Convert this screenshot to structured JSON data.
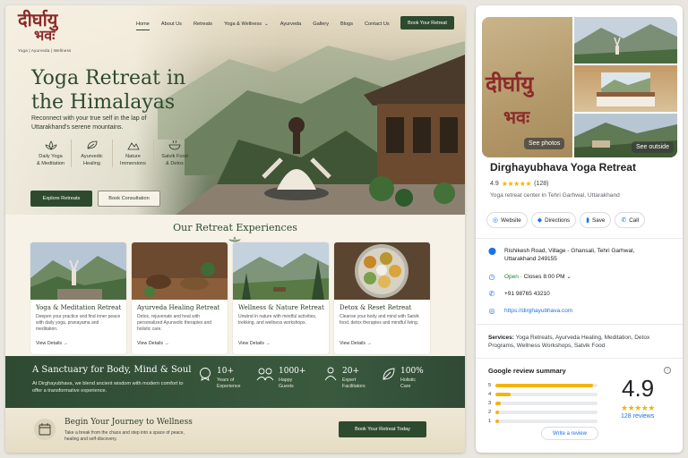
{
  "site": {
    "logo": {
      "line1": "दीर्घायु",
      "line2": "भवः",
      "tagline": "Yoga | Ayurveda | Wellness"
    },
    "nav": [
      "Home",
      "About Us",
      "Retreats",
      "Yoga & Wellness",
      "Ayurveda",
      "Gallery",
      "Blogs",
      "Contact Us"
    ],
    "nav_book": "Book Your Retreat",
    "hero": {
      "title_line1": "Yoga Retreat in",
      "title_line2": "the Himalayas",
      "subtitle": "Reconnect with your true self in the lap of Uttarakhand's serene mountains.",
      "features": [
        {
          "icon": "lotus-icon",
          "label1": "Daily Yoga",
          "label2": "& Meditation"
        },
        {
          "icon": "leaf-icon",
          "label1": "Ayurvedic",
          "label2": "Healing"
        },
        {
          "icon": "mountain-icon",
          "label1": "Nature",
          "label2": "Immersions"
        },
        {
          "icon": "bowl-icon",
          "label1": "Satvik Food",
          "label2": "& Detox"
        }
      ],
      "btn_primary": "Explore Retreats",
      "btn_secondary": "Book Consultation"
    },
    "experiences_title": "Our Retreat Experiences",
    "cards": [
      {
        "title": "Yoga & Meditation Retreat",
        "desc": "Deepen your practice and find inner peace with daily yoga, pranayama and meditation.",
        "link": "View Details →"
      },
      {
        "title": "Ayurveda Healing Retreat",
        "desc": "Detox, rejuvenate and heal with personalized Ayurvedic therapies and holistic care.",
        "link": "View Details →"
      },
      {
        "title": "Wellness & Nature Retreat",
        "desc": "Unwind in nature with mindful activities, trekking, and wellness workshops.",
        "link": "View Details →"
      },
      {
        "title": "Detox & Reset Retreat",
        "desc": "Cleanse your body and mind with Satvik food, detox therapies and mindful living.",
        "link": "View Details →"
      }
    ],
    "band": {
      "title": "A Sanctuary for Body, Mind & Soul",
      "desc": "At Dirghayubhava, we blend ancient wisdom with modern comfort to offer a transformative experience.",
      "stats": [
        {
          "icon": "badge-icon",
          "num": "10+",
          "l1": "Years of",
          "l2": "Experience"
        },
        {
          "icon": "people-icon",
          "num": "1000+",
          "l1": "Happy",
          "l2": "Guests"
        },
        {
          "icon": "teacher-icon",
          "num": "20+",
          "l1": "Expert",
          "l2": "Facilitators"
        },
        {
          "icon": "leaf-icon",
          "num": "100%",
          "l1": "Holistic",
          "l2": "Care"
        }
      ]
    },
    "journey": {
      "title": "Begin Your Journey to Wellness",
      "desc": "Take a break from the chaos and step into a space of peace, healing and self-discovery.",
      "btn": "Book Your Retreat Today"
    }
  },
  "gmaps": {
    "see_photos": "See photos",
    "see_outside": "See outside",
    "logo_line1": "दीर्घायु",
    "logo_line2": "भवः",
    "name": "Dirghayubhava Yoga Retreat",
    "rating": "4.9",
    "stars": "★★★★★",
    "reviews_count": "(128)",
    "category": "Yoga retreat center in Tehri Garhwal, Uttarakhand",
    "actions": [
      {
        "icon": "globe-icon",
        "label": "Website"
      },
      {
        "icon": "directions-icon",
        "label": "Directions"
      },
      {
        "icon": "bookmark-icon",
        "label": "Save"
      },
      {
        "icon": "phone-icon",
        "label": "Call"
      }
    ],
    "address": "Rishikesh Road, Village - Ghansali, Tehri Garhwal, Uttarakhand 249155",
    "hours_status": "Open",
    "hours_close": " · Closes 8:00 PM",
    "phone": "+91 98765 43210",
    "website": "https://dirghayubhava.com",
    "services_label": "Services:",
    "services": " Yoga Retreats, Ayurveda Healing, Meditation, Detox Programs, Wellness Workshops, Satvik Food",
    "review_summary_title": "Google review summary",
    "breakdown": [
      {
        "star": "5",
        "fraction": 0.95
      },
      {
        "star": "4",
        "fraction": 0.15
      },
      {
        "star": "3",
        "fraction": 0.05
      },
      {
        "star": "2",
        "fraction": 0.03
      },
      {
        "star": "1",
        "fraction": 0.03
      }
    ],
    "big_rating": "4.9",
    "reviews_link": "128 reviews",
    "write_review": "Write a review",
    "colors": {
      "accent": "#1a73e8",
      "star": "#f5b400",
      "brand": "#2e4a2e"
    }
  }
}
